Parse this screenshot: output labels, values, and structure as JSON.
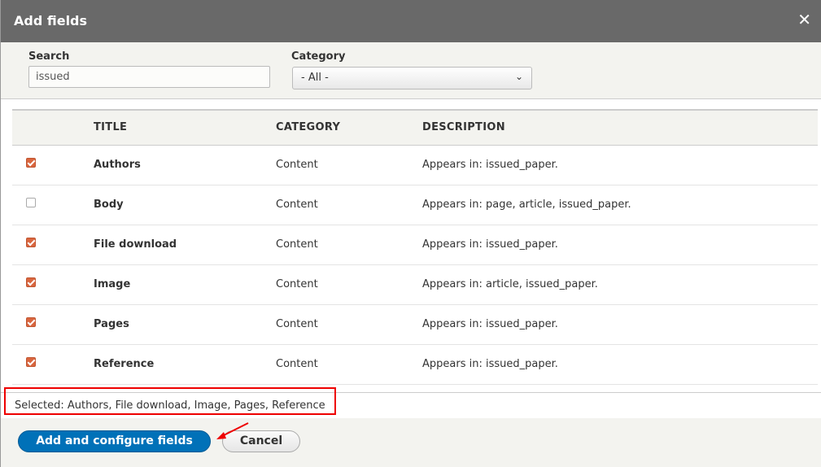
{
  "dialog": {
    "title": "Add fields",
    "close_icon": "close-icon"
  },
  "filters": {
    "search_label": "Search",
    "search_value": "issued",
    "category_label": "Category",
    "category_value": "- All -"
  },
  "table": {
    "headers": [
      "",
      "TITLE",
      "CATEGORY",
      "DESCRIPTION"
    ],
    "rows": [
      {
        "checked": true,
        "title": "Authors",
        "category": "Content",
        "description": "Appears in: issued_paper."
      },
      {
        "checked": false,
        "title": "Body",
        "category": "Content",
        "description": "Appears in: page, article, issued_paper."
      },
      {
        "checked": true,
        "title": "File download",
        "category": "Content",
        "description": "Appears in: issued_paper."
      },
      {
        "checked": true,
        "title": "Image",
        "category": "Content",
        "description": "Appears in: article, issued_paper."
      },
      {
        "checked": true,
        "title": "Pages",
        "category": "Content",
        "description": "Appears in: issued_paper."
      },
      {
        "checked": true,
        "title": "Reference",
        "category": "Content",
        "description": "Appears in: issued_paper."
      }
    ]
  },
  "selected_text": "Selected: Authors, File download, Image, Pages, Reference",
  "footer": {
    "primary_label": "Add and configure fields",
    "cancel_label": "Cancel"
  },
  "colors": {
    "titlebar": "#696969",
    "primary": "#0071b8",
    "checkbox": "#d9663f",
    "highlight": "#e00000"
  }
}
